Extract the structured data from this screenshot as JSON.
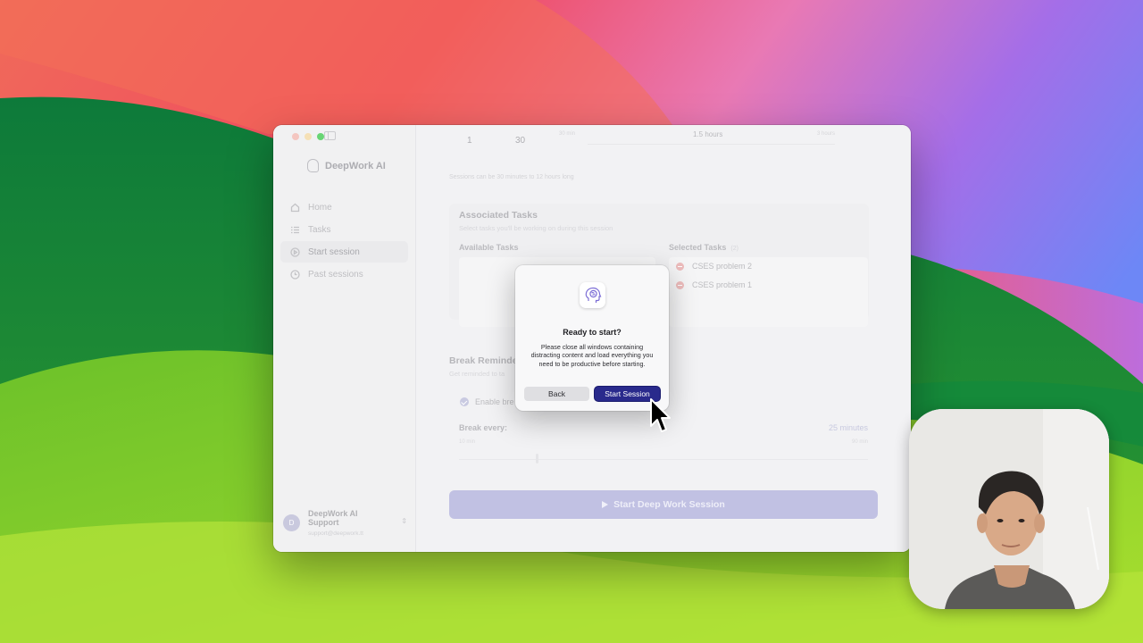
{
  "app": {
    "brand_name": "DeepWork AI"
  },
  "sidebar": {
    "items": [
      {
        "label": "Home",
        "icon": "home-icon",
        "active": false
      },
      {
        "label": "Tasks",
        "icon": "tasks-icon",
        "active": false
      },
      {
        "label": "Start session",
        "icon": "play-circle-icon",
        "active": true
      },
      {
        "label": "Past sessions",
        "icon": "history-icon",
        "active": false
      }
    ],
    "account": {
      "avatar_initial": "D",
      "name": "DeepWork AI Support",
      "email": "support@deepwork.tt"
    }
  },
  "duration": {
    "hours_value": "1",
    "minutes_value": "30",
    "tick_min": "30 min",
    "tick_mid": "1.5 hours",
    "tick_max": "3 hours",
    "hint": "Sessions can be 30 minutes to 12 hours long"
  },
  "tasks_card": {
    "title": "Associated Tasks",
    "subtitle": "Select tasks you'll be working on during this session",
    "available_label": "Available Tasks",
    "selected_label": "Selected Tasks",
    "selected_count": "(2)",
    "selected_tasks": [
      "CSES problem 2",
      "CSES problem 1"
    ]
  },
  "break_reminders": {
    "title": "Break Reminde",
    "subtitle": "Get reminded to ta",
    "enable_label": "Enable bre",
    "enabled": true,
    "break_every_label": "Break every:",
    "break_every_value": "25 minutes",
    "break_every_fraction": 0.19,
    "range_min": "10 min",
    "range_max": "90 min"
  },
  "start_button_label": "Start Deep Work Session",
  "dialog": {
    "title": "Ready to start?",
    "body": "Please close all windows containing distracting content and load everything you need to be productive before starting.",
    "back_label": "Back",
    "start_label": "Start Session",
    "icon": "brain-head-icon"
  },
  "colors": {
    "primary": "#292a8c",
    "start_button_disabled": "#a9a9d9",
    "remove_dot": "#e6a3a3"
  }
}
